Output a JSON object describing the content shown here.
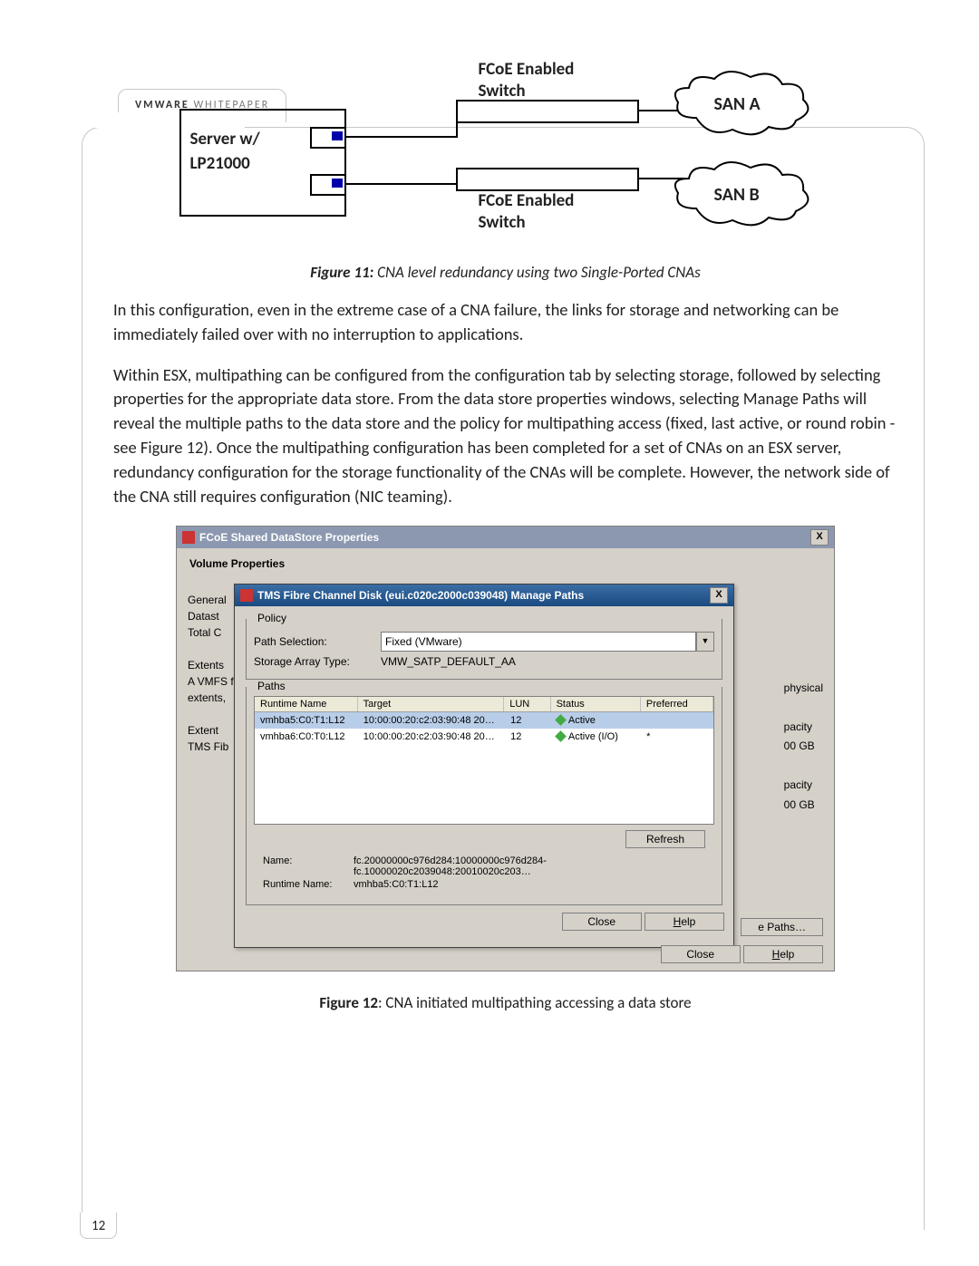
{
  "header": {
    "brand": "VMWARE",
    "rest": " WHITEPAPER"
  },
  "diagram": {
    "server": "Server w/\nLP21000",
    "switch": "FCoE Enabled\nSwitch",
    "sanA": "SAN A",
    "sanB": "SAN B"
  },
  "fig11_strong": "Figure 11:",
  "fig11_rest": " CNA level redundancy using two Single-Ported CNAs",
  "para1": "In this configuration, even in the extreme case of a CNA failure, the links for storage and networking can be immediately failed over with no interruption to applications.",
  "para2": "Within ESX, multipathing can be configured from the configuration tab by selecting storage, followed by selecting properties for the appropriate data store. From the data store properties windows, selecting Manage Paths will reveal the multiple paths to the data store and the policy for multipathing access (fixed, last active, or round robin - see Figure 12). Once the multipathing configuration has been completed for a set of CNAs on an ESX server, redundancy configuration for the storage functionality of the CNAs will be complete. However, the network side of the CNA still requires configuration (NIC teaming).",
  "outer": {
    "title": "FCoE Shared DataStore Properties",
    "close": "X",
    "vp": "Volume Properties",
    "side": [
      "General",
      "Datast",
      "Total C",
      "",
      "Extents",
      "A VMFS f",
      "extents,",
      "",
      "Extent",
      "TMS Fib"
    ],
    "right": [
      "physical",
      "",
      "pacity",
      "00 GB",
      "",
      "pacity",
      "00 GB"
    ],
    "ePaths": "e Paths…",
    "closeBtn": "Close",
    "helpBtn": "Help"
  },
  "inner": {
    "title": "TMS Fibre Channel Disk (eui.c020c2000c039048) Manage Paths",
    "close": "X",
    "policy": "Policy",
    "pathSel": "Path Selection:",
    "pathSelVal": "Fixed (VMware)",
    "sat": "Storage Array Type:",
    "satVal": "VMW_SATP_DEFAULT_AA",
    "paths": "Paths",
    "cols": [
      "Runtime Name",
      "Target",
      "LUN",
      "Status",
      "Preferred"
    ],
    "rows": [
      {
        "rt": "vmhba5:C0:T1:L12",
        "tg": "10:00:00:20:c2:03:90:48 20…",
        "lun": "12",
        "st": "Active",
        "pref": ""
      },
      {
        "rt": "vmhba6:C0:T0:L12",
        "tg": "10:00:00:20:c2:03:90:48 20…",
        "lun": "12",
        "st": "Active (I/O)",
        "pref": "*"
      }
    ],
    "refresh": "Refresh",
    "nameL": "Name:",
    "nameV": "fc.20000000c976d284:10000000c976d284-fc.10000020c2039048:20010020c203…",
    "rtL": "Runtime Name:",
    "rtV": "vmhba5:C0:T1:L12",
    "closeBtn": "Close",
    "helpBtn": "Help"
  },
  "fig12_strong": "Figure 12",
  "fig12_rest": ":  CNA initiated multipathing accessing a data store",
  "pagenum": "12"
}
